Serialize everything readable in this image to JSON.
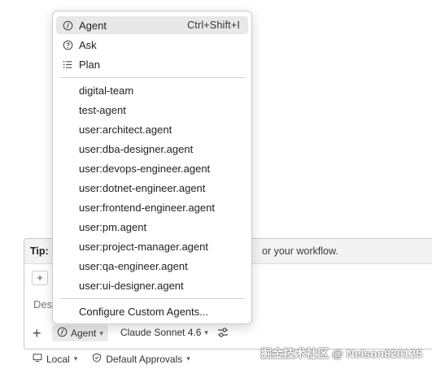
{
  "tip": {
    "label": "Tip:",
    "text": "or your workflow."
  },
  "input": {
    "context_chip": "+",
    "placeholder_fragment": "Des"
  },
  "toolbar": {
    "add_label": "+",
    "mode_label": "Agent",
    "model_label": "Claude Sonnet 4.6"
  },
  "bottom": {
    "location_label": "Local",
    "approvals_label": "Default Approvals"
  },
  "watermark": "掘金技术社区 @ Nelson820125",
  "menu": {
    "modes": [
      {
        "label": "Agent",
        "shortcut": "Ctrl+Shift+I",
        "icon": "agent-icon",
        "selected": true
      },
      {
        "label": "Ask",
        "icon": "ask-icon"
      },
      {
        "label": "Plan",
        "icon": "plan-icon"
      }
    ],
    "agents": [
      "digital-team",
      "test-agent",
      "user:architect.agent",
      "user:dba-designer.agent",
      "user:devops-engineer.agent",
      "user:dotnet-engineer.agent",
      "user:frontend-engineer.agent",
      "user:pm.agent",
      "user:project-manager.agent",
      "user:qa-engineer.agent",
      "user:ui-designer.agent"
    ],
    "configure_label": "Configure Custom Agents..."
  }
}
